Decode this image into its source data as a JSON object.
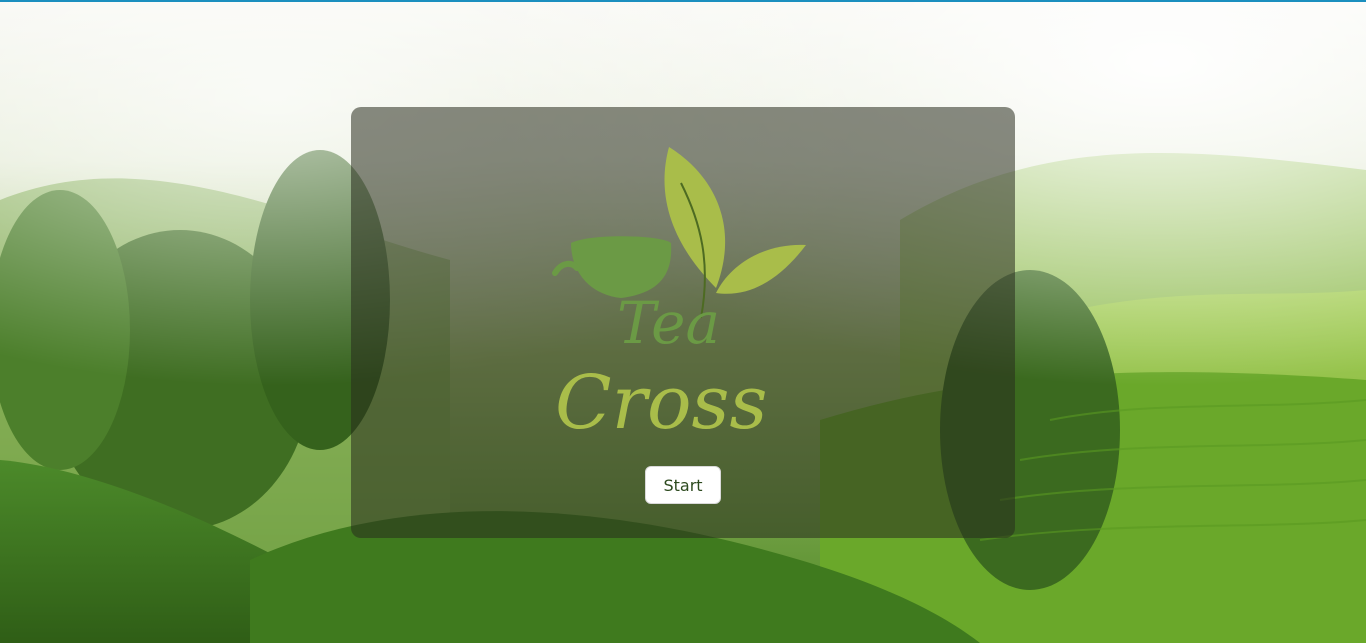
{
  "app": {
    "accent_color": "#1b8fbf"
  },
  "logo": {
    "line1": "Tea",
    "line2": "Cross",
    "leaf_color": "#a9bd4a",
    "cup_color": "#6b9a45"
  },
  "actions": {
    "start_label": "Start"
  }
}
